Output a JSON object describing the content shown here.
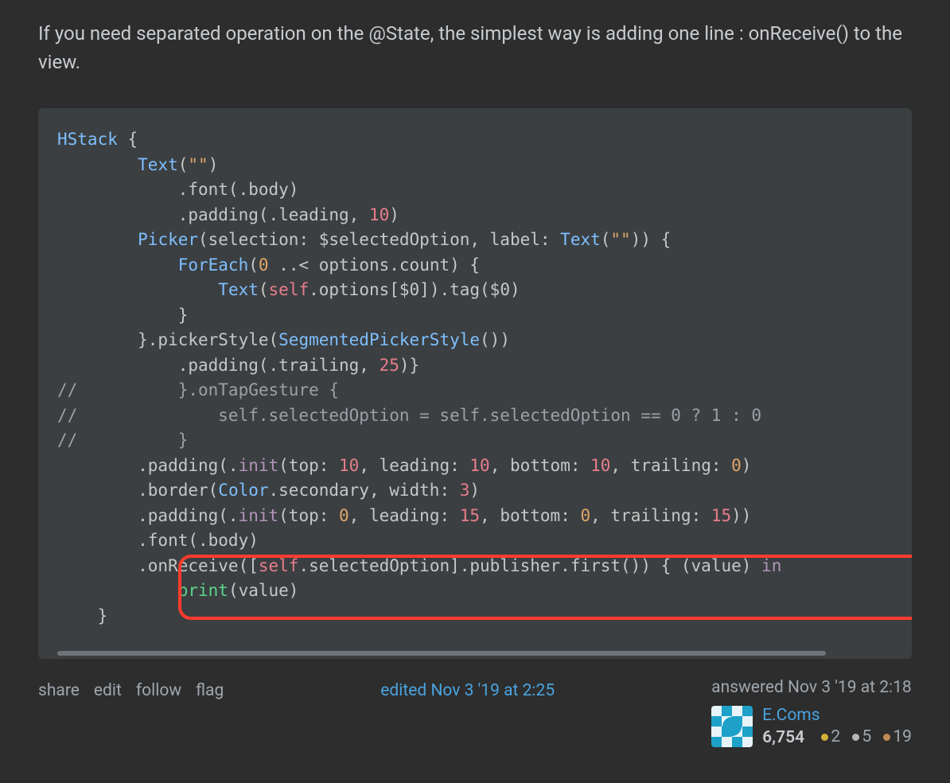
{
  "answer": {
    "text": "If you need separated operation on the @State, the simplest way is adding one line : onReceive() to the view."
  },
  "code": {
    "line1_HStack": "HStack",
    "line1_brace": " {",
    "line2_indent": "        ",
    "line2_Text": "Text",
    "line2_paren": "(",
    "line2_str": "\"\"",
    "line2_close": ")",
    "line3": "            .font(.body)",
    "line4_a": "            .padding(.leading, ",
    "line4_num": "10",
    "line4_b": ")",
    "line5_indent": "        ",
    "line5_Picker": "Picker",
    "line5_a": "(selection: $selectedOption, label: ",
    "line5_Text": "Text",
    "line5_p": "(",
    "line5_str": "\"\"",
    "line5_b": ")) {",
    "line6_indent": "            ",
    "line6_ForEach": "ForEach",
    "line6_p": "(",
    "line6_zero": "0",
    "line6_a": " ..< options.count) {",
    "line7_indent": "                ",
    "line7_Text": "Text",
    "line7_p": "(",
    "line7_self": "self",
    "line7_a": ".options[$0]).tag($0)",
    "line8": "            }",
    "line9_a": "        }.pickerStyle(",
    "line9_Seg": "SegmentedPickerStyle",
    "line9_b": "())",
    "line10_a": "            .padding(.trailing, ",
    "line10_num": "25",
    "line10_b": ")}",
    "line11": "//          }.onTapGesture {",
    "line12": "//              self.selectedOption = self.selectedOption == 0 ? 1 : 0",
    "line13": "//          }",
    "line14_a": "        .padding(.",
    "line14_init": "init",
    "line14_b": "(top: ",
    "line14_n1": "10",
    "line14_c": ", leading: ",
    "line14_n2": "10",
    "line14_d": ", bottom: ",
    "line14_n3": "10",
    "line14_e": ", trailing: ",
    "line14_n4": "0",
    "line14_f": ")",
    "line15_a": "        .border(",
    "line15_Color": "Color",
    "line15_b": ".secondary, width: ",
    "line15_n": "3",
    "line15_c": ")",
    "line16_a": "        .padding(.",
    "line16_init": "init",
    "line16_b": "(top: ",
    "line16_n1": "0",
    "line16_c": ", leading: ",
    "line16_n2": "15",
    "line16_d": ", bottom: ",
    "line16_n3": "0",
    "line16_e": ", trailing: ",
    "line16_n4": "15",
    "line16_f": "))",
    "line17": "        .font(.body)",
    "line18_a": "        .onReceive([",
    "line18_self": "self",
    "line18_b": ".selectedOption].publisher.first()) { (value) ",
    "line18_in": "in",
    "line19_a": "            ",
    "line19_print": "print",
    "line19_b": "(value)",
    "line20": "    }"
  },
  "actions": {
    "share": "share",
    "edit": "edit",
    "follow": "follow",
    "flag": "flag"
  },
  "edited": "edited Nov 3 '19 at 2:25",
  "answered": "answered Nov 3 '19 at 2:18",
  "user": {
    "name": "E.Coms",
    "rep": "6,754",
    "gold": "2",
    "silver": "5",
    "bronze": "19"
  }
}
